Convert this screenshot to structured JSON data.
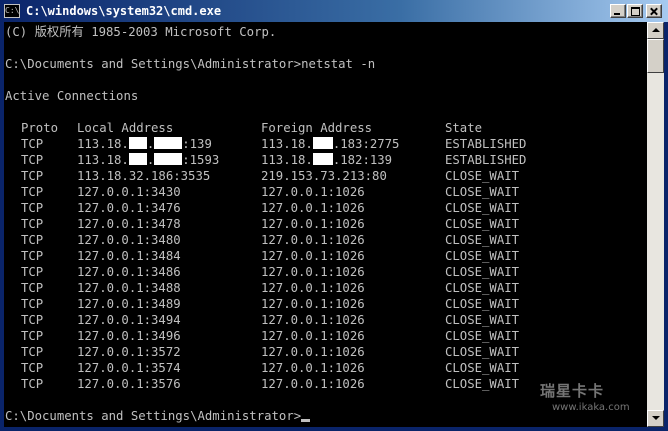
{
  "window": {
    "title": "C:\\windows\\system32\\cmd.exe",
    "icon_name": "console-icon",
    "controls": [
      "minimize-icon",
      "maximize-icon",
      "close-icon"
    ]
  },
  "console": {
    "copyright": "(C) 版权所有 1985-2003 Microsoft Corp.",
    "command_line": "C:\\Documents and Settings\\Administrator>netstat -n",
    "section_title": "Active Connections",
    "headers": {
      "proto": "Proto",
      "local": "Local Address",
      "foreign": "Foreign Address",
      "state": "State"
    },
    "rows": [
      {
        "proto": "TCP",
        "local_a": "113.18.",
        "local_b": ":139",
        "foreign_a": "113.18.",
        "foreign_b": ".183:2775",
        "state": "ESTABLISHED"
      },
      {
        "proto": "TCP",
        "local_a": "113.18.",
        "local_b": ":1593",
        "foreign_a": "113.18.",
        "foreign_b": ".182:139",
        "state": "ESTABLISHED"
      },
      {
        "proto": "TCP",
        "local": "113.18.32.186:3535",
        "foreign": "219.153.73.213:80",
        "state": "CLOSE_WAIT"
      },
      {
        "proto": "TCP",
        "local": "127.0.0.1:3430",
        "foreign": "127.0.0.1:1026",
        "state": "CLOSE_WAIT"
      },
      {
        "proto": "TCP",
        "local": "127.0.0.1:3476",
        "foreign": "127.0.0.1:1026",
        "state": "CLOSE_WAIT"
      },
      {
        "proto": "TCP",
        "local": "127.0.0.1:3478",
        "foreign": "127.0.0.1:1026",
        "state": "CLOSE_WAIT"
      },
      {
        "proto": "TCP",
        "local": "127.0.0.1:3480",
        "foreign": "127.0.0.1:1026",
        "state": "CLOSE_WAIT"
      },
      {
        "proto": "TCP",
        "local": "127.0.0.1:3484",
        "foreign": "127.0.0.1:1026",
        "state": "CLOSE_WAIT"
      },
      {
        "proto": "TCP",
        "local": "127.0.0.1:3486",
        "foreign": "127.0.0.1:1026",
        "state": "CLOSE_WAIT"
      },
      {
        "proto": "TCP",
        "local": "127.0.0.1:3488",
        "foreign": "127.0.0.1:1026",
        "state": "CLOSE_WAIT"
      },
      {
        "proto": "TCP",
        "local": "127.0.0.1:3489",
        "foreign": "127.0.0.1:1026",
        "state": "CLOSE_WAIT"
      },
      {
        "proto": "TCP",
        "local": "127.0.0.1:3494",
        "foreign": "127.0.0.1:1026",
        "state": "CLOSE_WAIT"
      },
      {
        "proto": "TCP",
        "local": "127.0.0.1:3496",
        "foreign": "127.0.0.1:1026",
        "state": "CLOSE_WAIT"
      },
      {
        "proto": "TCP",
        "local": "127.0.0.1:3572",
        "foreign": "127.0.0.1:1026",
        "state": "CLOSE_WAIT"
      },
      {
        "proto": "TCP",
        "local": "127.0.0.1:3574",
        "foreign": "127.0.0.1:1026",
        "state": "CLOSE_WAIT"
      },
      {
        "proto": "TCP",
        "local": "127.0.0.1:3576",
        "foreign": "127.0.0.1:1026",
        "state": "CLOSE_WAIT"
      }
    ],
    "prompt": "C:\\Documents and Settings\\Administrator>"
  },
  "watermark": {
    "logo": "瑞星卡卡",
    "url": "www.ikaka.com"
  },
  "colors": {
    "console_bg": "#000000",
    "console_text": "#c0c0c0",
    "titlebar_start": "#0a246a",
    "titlebar_end": "#a6caf0"
  }
}
